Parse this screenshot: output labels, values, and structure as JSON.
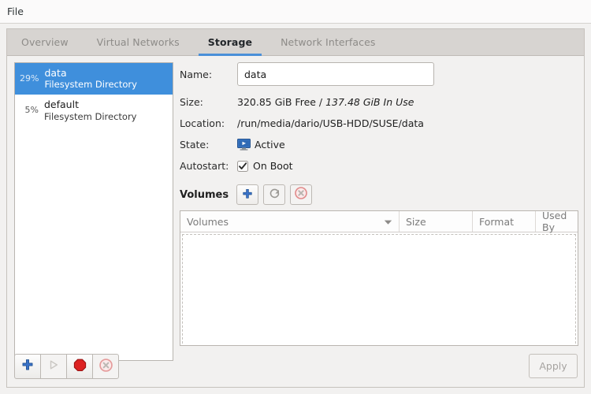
{
  "menubar": {
    "items": [
      {
        "label": "File"
      }
    ]
  },
  "tabs": [
    {
      "label": "Overview",
      "active": false
    },
    {
      "label": "Virtual Networks",
      "active": false
    },
    {
      "label": "Storage",
      "active": true
    },
    {
      "label": "Network Interfaces",
      "active": false
    }
  ],
  "accent_color": "#4a90d9",
  "selection_color": "#3f8fdc",
  "pools": [
    {
      "percent": "29%",
      "name": "data",
      "type": "Filesystem Directory",
      "selected": true
    },
    {
      "percent": "5%",
      "name": "default",
      "type": "Filesystem Directory",
      "selected": false
    }
  ],
  "detail": {
    "name_label": "Name:",
    "name_value": "data",
    "name_placeholder": "",
    "size_label": "Size:",
    "size_free": "320.85 GiB Free / ",
    "size_in_use": "137.48 GiB In Use",
    "location_label": "Location:",
    "location_value": "/run/media/dario/USB-HDD/SUSE/data",
    "state_label": "State:",
    "state_value": "Active",
    "autostart_label": "Autostart:",
    "autostart_value": "On Boot",
    "autostart_checked": true
  },
  "volumes": {
    "title": "Volumes",
    "add_label": "add-volume",
    "refresh_label": "refresh-volumes",
    "delete_label": "delete-volume",
    "columns": [
      {
        "label": "Volumes",
        "sorted": true
      },
      {
        "label": "Size",
        "sorted": false
      },
      {
        "label": "Format",
        "sorted": false
      },
      {
        "label": "Used By",
        "sorted": false
      }
    ],
    "rows": []
  },
  "bottombar": {
    "add_label": "add-pool",
    "start_label": "start-pool",
    "stop_label": "stop-pool",
    "delete_label": "delete-pool",
    "apply_label": "Apply"
  }
}
